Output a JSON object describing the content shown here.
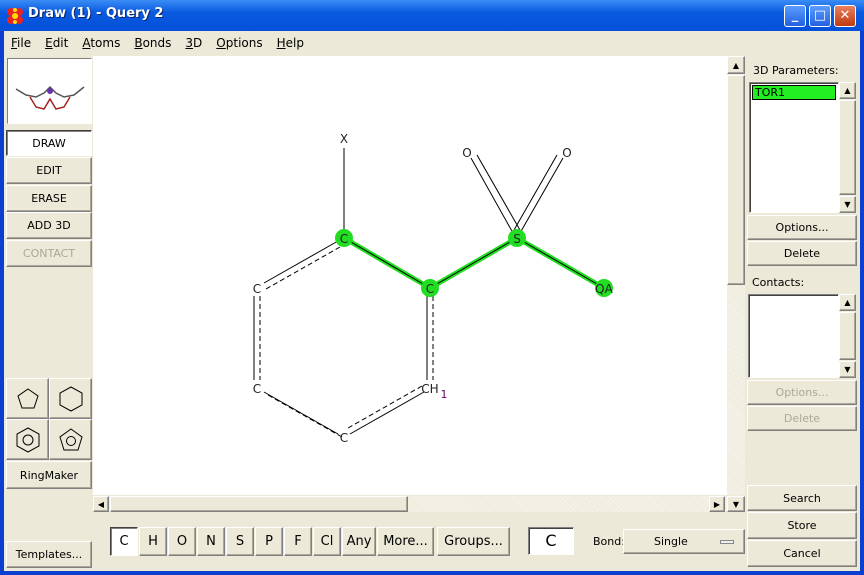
{
  "window": {
    "title": "Draw (1) - Query 2",
    "controls": {
      "minimize": "_",
      "maximize": "□",
      "close": "✕"
    }
  },
  "menu": [
    "File",
    "Edit",
    "Atoms",
    "Bonds",
    "3D",
    "Options",
    "Help"
  ],
  "modes": {
    "draw": "DRAW",
    "edit": "EDIT",
    "erase": "ERASE",
    "add3d": "ADD 3D",
    "contact": "CONTACT"
  },
  "ringmaker": "RingMaker",
  "templates": "Templates...",
  "molecule": {
    "atoms": {
      "x": "X",
      "c1": "C",
      "c2": "C",
      "s": "S",
      "o1": "O",
      "o2": "O",
      "qa": "QA",
      "c3": "C",
      "c4": "C",
      "c5": "C",
      "ch": "CH",
      "ch_sub": "1"
    },
    "highlight_color": "#22dd22"
  },
  "elements": [
    "C",
    "H",
    "O",
    "N",
    "S",
    "P",
    "F",
    "Cl",
    "Any",
    "More...",
    "Groups..."
  ],
  "current_element": "C",
  "bond": {
    "label": "Bond:",
    "value": "Single"
  },
  "params3d": {
    "label": "3D Parameters:",
    "items": [
      "TOR1"
    ],
    "options": "Options...",
    "delete": "Delete"
  },
  "contacts": {
    "label": "Contacts:",
    "options": "Options...",
    "delete": "Delete"
  },
  "actions": {
    "search": "Search",
    "store": "Store",
    "cancel": "Cancel"
  }
}
